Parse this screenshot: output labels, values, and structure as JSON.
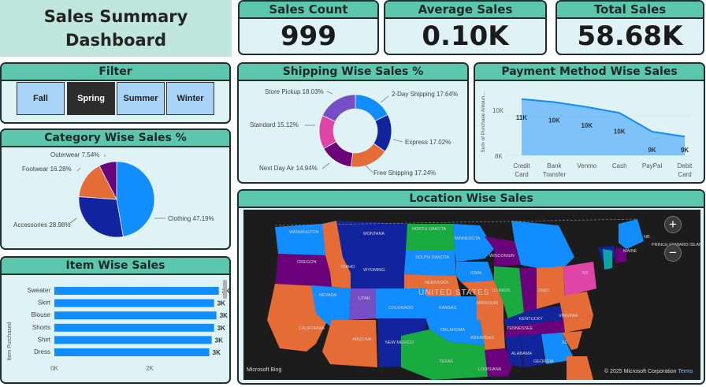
{
  "dashboard": {
    "title_line1": "Sales Summary",
    "title_line2": "Dashboard"
  },
  "kpis": [
    {
      "label": "Sales Count",
      "value": "999"
    },
    {
      "label": "Average Sales",
      "value": "0.10K"
    },
    {
      "label": "Total Sales",
      "value": "58.68K"
    }
  ],
  "filter": {
    "title": "Filter",
    "options": [
      "Fall",
      "Spring",
      "Summer",
      "Winter"
    ],
    "selected": "Spring"
  },
  "category_chart": {
    "title": "Category Wise Sales %",
    "slice_labels": [
      "Clothing 47.19%",
      "Accessories 28.98%",
      "Footwear 16.28%",
      "Outerwear 7.54%"
    ]
  },
  "shipping_chart": {
    "title": "Shipping Wise Sales %",
    "slice_labels": [
      "2-Day Shipping 17.64%",
      "Express 17.02%",
      "Free Shipping 17.24%",
      "Next Day Air 14.94%",
      "Standard 15.12%",
      "Store Pickup 18.03%"
    ]
  },
  "payment_chart": {
    "title": "Payment Method Wise Sales",
    "ylabel": "Sum of Purchase Amoun...",
    "ytick_labels": [
      "10K",
      "8K"
    ],
    "data_labels": [
      "11K",
      "10K",
      "10K",
      "10K",
      "9K",
      "9K"
    ],
    "category_lines": [
      [
        "Credit",
        "Card"
      ],
      [
        "Bank",
        "Transfer"
      ],
      [
        "Venmo"
      ],
      [
        "Cash"
      ],
      [
        "PayPal"
      ],
      [
        "Debit",
        "Card"
      ]
    ]
  },
  "item_chart": {
    "title": "Item Wise Sales",
    "ylabel": "Item Purchased",
    "data_label": "3K",
    "xtick_labels": [
      "0K",
      "2K"
    ]
  },
  "map": {
    "title": "Location Wise Sales",
    "country_label": "UNITED STATES",
    "state_labels": [
      "WASHINGTON",
      "MONTANA",
      "NORTH DAKOTA",
      "MINNESOTA",
      "OREGON",
      "IDAHO",
      "WYOMING",
      "SOUTH DAKOTA",
      "WISCONSIN",
      "NEBRASKA",
      "IOWA",
      "NEVADA",
      "UTAH",
      "COLORADO",
      "KANSAS",
      "MISSOURI",
      "ILLINOIS",
      "CALIFORNIA",
      "ARIZONA",
      "NEW MEXICO",
      "OKLAHOMA",
      "ARKANSAS",
      "TENNESSEE",
      "TEXAS",
      "LOUISIANA",
      "ALABAMA",
      "GEORGIA",
      "OHIO",
      "KENTUCKY",
      "VIRGINIA",
      "SC",
      "MAINE",
      "NY",
      "NB",
      "PRINCE EDWARD ISLAND"
    ],
    "attribution": "Microsoft Bing",
    "copyright": "© 2025 Microsoft Corporation",
    "terms_link": "Terms",
    "zoom_in": "+",
    "zoom_out": "−"
  },
  "colors": {
    "header": "#5dc7ad",
    "panel_bg": "#dff2f5",
    "title_bg": "#bfe7de",
    "bar_blue": "#118dff",
    "area_blue": "#118dff"
  },
  "chart_data": [
    {
      "type": "pie",
      "title": "Category Wise Sales %",
      "categories": [
        "Clothing",
        "Accessories",
        "Footwear",
        "Outerwear"
      ],
      "values": [
        47.19,
        28.98,
        16.28,
        7.54
      ],
      "colors": [
        "#118dff",
        "#12239e",
        "#e66c37",
        "#6b007b"
      ]
    },
    {
      "type": "pie",
      "title": "Shipping Wise Sales %",
      "categories": [
        "2-Day Shipping",
        "Express",
        "Free Shipping",
        "Next Day Air",
        "Standard",
        "Store Pickup"
      ],
      "values": [
        17.64,
        17.02,
        17.24,
        14.94,
        15.12,
        18.03
      ],
      "colors": [
        "#118dff",
        "#12239e",
        "#e66c37",
        "#6b007b",
        "#e044a7",
        "#744ec2"
      ]
    },
    {
      "type": "area",
      "title": "Payment Method Wise Sales",
      "categories": [
        "Credit Card",
        "Bank Transfer",
        "Venmo",
        "Cash",
        "PayPal",
        "Debit Card"
      ],
      "values": [
        10850,
        10700,
        10450,
        10150,
        9200,
        8950
      ],
      "ylabel": "Sum of Purchase Amoun...",
      "ylim": [
        8000,
        11200
      ],
      "yticks": [
        10000,
        8000
      ]
    },
    {
      "type": "bar",
      "orientation": "horizontal",
      "title": "Item Wise Sales",
      "categories": [
        "Sweater",
        "Skirt",
        "Blouse",
        "Shorts",
        "Shirt",
        "Dress"
      ],
      "values": [
        3450,
        3350,
        3400,
        3350,
        3300,
        3250
      ],
      "ylabel": "Item Purchased",
      "xlim": [
        0,
        3700
      ],
      "xticks": [
        0,
        2000
      ]
    }
  ]
}
